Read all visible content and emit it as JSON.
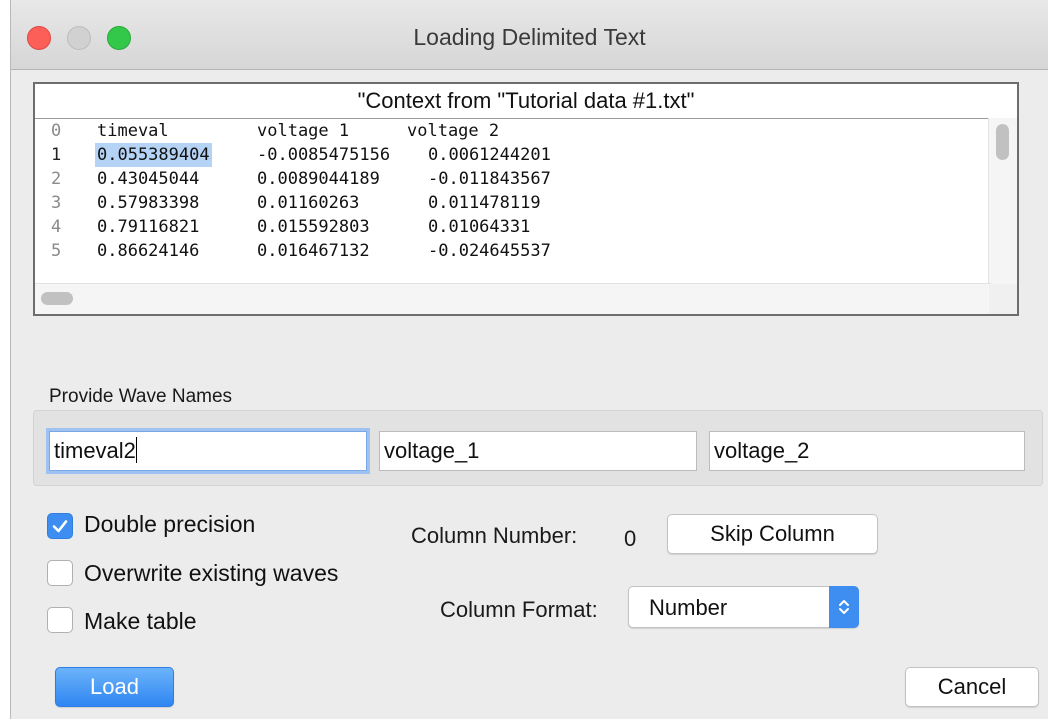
{
  "window": {
    "title": "Loading Delimited Text"
  },
  "preview": {
    "header": "\"Context from \"Tutorial data #1.txt\"",
    "rows": [
      {
        "line": "0",
        "c1": "timeval",
        "c2": "voltage 1",
        "c3": "voltage 2"
      },
      {
        "line": "1",
        "c1": "0.055389404",
        "c2": "-0.0085475156",
        "c3": "0.0061244201"
      },
      {
        "line": "2",
        "c1": "0.43045044",
        "c2": "0.0089044189",
        "c3": "-0.011843567"
      },
      {
        "line": "3",
        "c1": "0.57983398",
        "c2": "0.01160263",
        "c3": "0.011478119"
      },
      {
        "line": "4",
        "c1": "0.79116821",
        "c2": "0.015592803",
        "c3": "0.01064331"
      },
      {
        "line": "5",
        "c1": "0.86624146",
        "c2": "0.016467132",
        "c3": "-0.024645537"
      }
    ]
  },
  "wave_names": {
    "label": "Provide Wave Names",
    "fields": [
      "timeval2",
      "voltage_1",
      "voltage_2"
    ]
  },
  "options": {
    "double_precision": {
      "label": "Double precision",
      "checked": true
    },
    "overwrite": {
      "label": "Overwrite existing waves",
      "checked": false
    },
    "make_table": {
      "label": "Make table",
      "checked": false
    }
  },
  "column": {
    "number_label": "Column Number:",
    "number_value": "0",
    "skip_label": "Skip Column",
    "format_label": "Column Format:",
    "format_value": "Number"
  },
  "buttons": {
    "load": "Load",
    "cancel": "Cancel"
  },
  "colors": {
    "accent": "#3d8ef0",
    "selection": "#b4d3f5",
    "close": "#fc5f57",
    "zoom": "#34c84a"
  }
}
